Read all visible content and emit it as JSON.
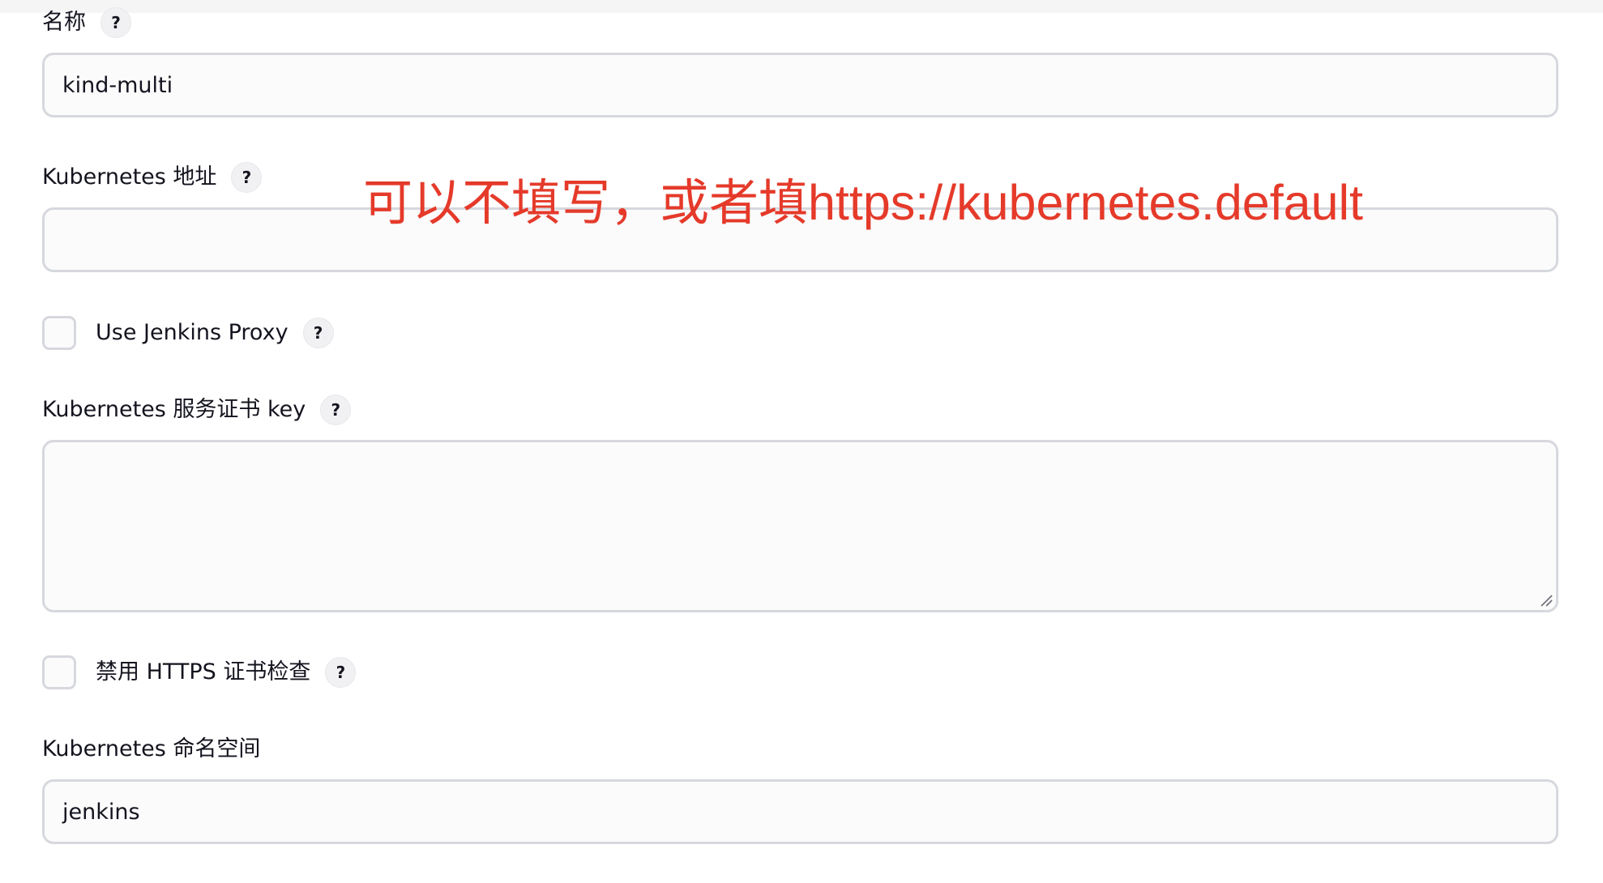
{
  "form": {
    "name": {
      "label": "名称",
      "help": "?",
      "value": "kind-multi"
    },
    "k8s_url": {
      "label": "Kubernetes 地址",
      "help": "?",
      "value": ""
    },
    "jenkins_proxy": {
      "label": "Use Jenkins Proxy",
      "help": "?",
      "checked": false
    },
    "server_cert": {
      "label": "Kubernetes 服务证书 key",
      "help": "?",
      "value": ""
    },
    "disable_https_check": {
      "label": "禁用 HTTPS 证书检查",
      "help": "?",
      "checked": false
    },
    "namespace": {
      "label": "Kubernetes 命名空间",
      "value": "jenkins"
    }
  },
  "annotation": {
    "text": "可以不填写，或者填https://kubernetes.default",
    "color": "#e53a2a"
  },
  "icons": {
    "help": "question-mark-icon",
    "resize": "resize-grip-icon"
  }
}
